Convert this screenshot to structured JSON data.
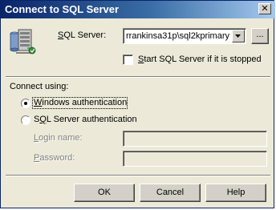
{
  "window": {
    "title": "Connect to SQL Server",
    "close_glyph": "✕"
  },
  "server": {
    "label_prefix": "",
    "label_underlined": "S",
    "label_rest": "QL Server:",
    "value": "rrankinsa31p\\sql2kprimary",
    "browse_label": "..."
  },
  "start_option": {
    "label_underlined": "S",
    "label_rest": "tart SQL Server if it is stopped",
    "checked": false
  },
  "connect": {
    "heading": "Connect using:",
    "windows_auth": {
      "label_underlined": "W",
      "label_rest": "indows authentication",
      "selected": true
    },
    "sql_auth": {
      "label_prefix": "S",
      "label_underlined": "Q",
      "label_rest": "L Server authentication",
      "selected": false
    },
    "login": {
      "label_underlined": "L",
      "label_rest": "ogin name:",
      "value": ""
    },
    "password": {
      "label_underlined": "P",
      "label_rest": "assword:",
      "value": ""
    }
  },
  "buttons": {
    "ok": "OK",
    "cancel": "Cancel",
    "help": "Help"
  },
  "colors": {
    "titlebar_start": "#0a246a",
    "titlebar_end": "#a6caf0",
    "dialog_bg": "#ece9d8",
    "disabled_text": "#808080"
  },
  "icons": {
    "app": "sql-server-icon",
    "dropdown": "chevron-down-icon"
  }
}
